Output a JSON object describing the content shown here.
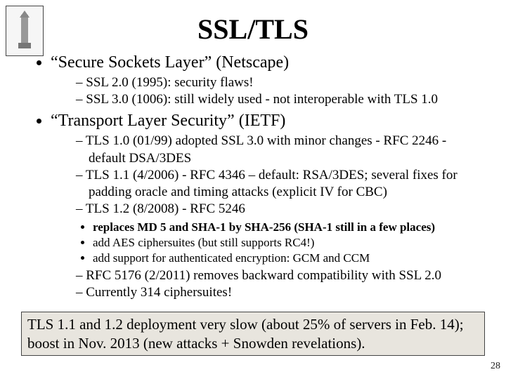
{
  "title": "SSL/TLS",
  "b1": {
    "heading": "“Secure Sockets Layer” (Netscape)",
    "sub": [
      "SSL 2.0 (1995): security flaws!",
      "SSL 3.0 (1006): still widely used - not interoperable with TLS 1.0"
    ]
  },
  "b2": {
    "heading": "“Transport Layer Security” (IETF)",
    "sub": [
      "TLS 1.0 (01/99) adopted SSL 3.0 with minor changes - RFC 2246 - default DSA/3DES",
      "TLS 1.1 (4/2006) - RFC 4346 – default: RSA/3DES; several fixes for padding oracle and timing attacks (explicit IV for CBC)",
      "TLS 1.2 (8/2008)  - RFC 5246"
    ],
    "subsub": [
      "replaces MD 5 and SHA-1 by SHA-256 (SHA-1 still in a few places)",
      "add AES ciphersuites (but still supports RC4!)",
      "add support for authenticated encryption: GCM and CCM"
    ],
    "sub2": [
      "RFC 5176 (2/2011) removes backward compatibility with SSL 2.0",
      "Currently 314 ciphersuites!"
    ]
  },
  "box": "TLS 1.1 and 1.2 deployment very slow (about 25% of servers in Feb. 14); boost in Nov. 2013 new attacks + Snowden revelations).",
  "box_pre": "TLS 1.1 and 1.2 deployment very slow (about 25% of servers in Feb. 14); boost in Nov. 2013 (new attacks + Snowden revelations).",
  "pagenum": "28"
}
